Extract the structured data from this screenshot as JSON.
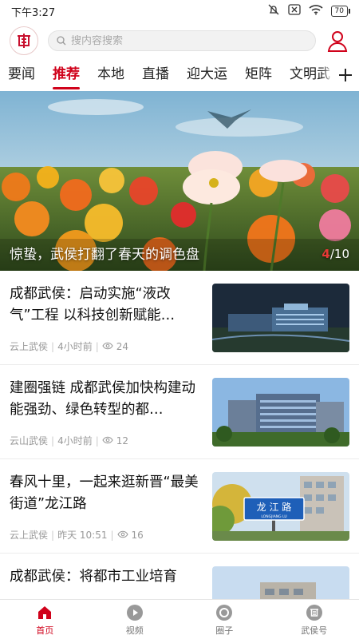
{
  "status": {
    "time": "下午3:27",
    "battery": "70"
  },
  "search": {
    "placeholder": "搜内容搜索"
  },
  "tabs": [
    "要闻",
    "推荐",
    "本地",
    "直播",
    "迎大运",
    "矩阵",
    "文明武"
  ],
  "active_tab": 1,
  "banner": {
    "title": "惊蛰，武侯打翻了春天的调色盘",
    "current": "4",
    "total": "/10"
  },
  "news": [
    {
      "title": "成都武侯：启动实施“液改气”工程 以科技创新赋能…",
      "source": "云上武侯",
      "time": "4小时前",
      "views": "24"
    },
    {
      "title": "建圈强链 成都武侯加快构建动能强劲、绿色转型的都…",
      "source": "云山武侯",
      "time": "4小时前",
      "views": "12"
    },
    {
      "title": "春风十里，一起来逛新晋“最美街道”龙江路",
      "source": "云上武侯",
      "time": "昨天 10:51",
      "views": "16"
    },
    {
      "title": "成都武侯：将都市工业培育",
      "source": "",
      "time": "",
      "views": ""
    }
  ],
  "thumb_sign": {
    "cn": "龙 江 路",
    "en": "LONGJIANG LU"
  },
  "bottom_nav": [
    "首页",
    "视频",
    "圈子",
    "武侯号"
  ],
  "colors": {
    "accent": "#d0021b"
  }
}
